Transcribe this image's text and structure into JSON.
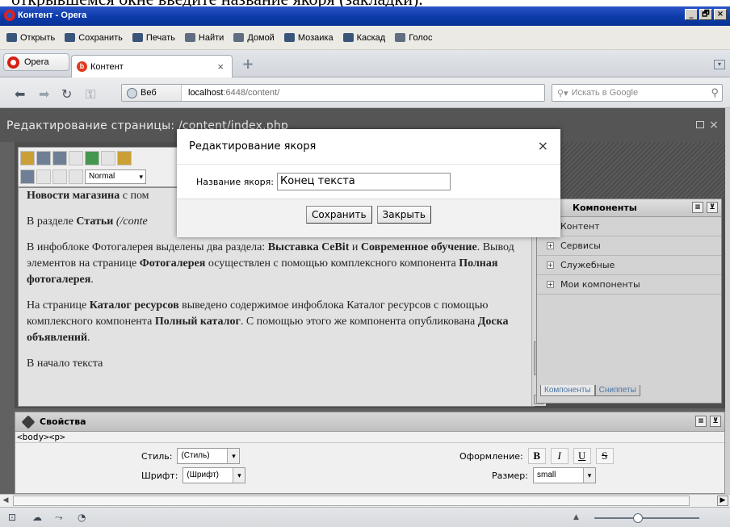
{
  "caption": "открывшемся окне введите название якоря (закладки).",
  "window": {
    "title": "Контент - Opera",
    "min": "_",
    "max": "🗗",
    "close": "×"
  },
  "toolbar": {
    "items": [
      {
        "label": "Открыть",
        "icon": "folder-icon"
      },
      {
        "label": "Сохранить",
        "icon": "save-icon"
      },
      {
        "label": "Печать",
        "icon": "print-icon"
      },
      {
        "label": "Найти",
        "icon": "search-icon"
      },
      {
        "label": "Домой",
        "icon": "home-icon"
      },
      {
        "label": "Мозаика",
        "icon": "tile-icon"
      },
      {
        "label": "Каскад",
        "icon": "cascade-icon"
      },
      {
        "label": "Голос",
        "icon": "voice-icon"
      }
    ]
  },
  "tabs": {
    "opera_menu": "Opera",
    "active_tab": "Контент",
    "tab_close": "×",
    "new_tab": "+",
    "tab_menu": "▾"
  },
  "address": {
    "web_label": "Веб",
    "url_host": "localhost",
    "url_rest": ":6448/content/",
    "search_placeholder": "Искать в Google"
  },
  "editor": {
    "title": "Редактирование страницы: /content/index.php",
    "style_select": "Normal",
    "paragraphs": [
      {
        "bold": "Новости магазина",
        "text": " с пом"
      },
      {
        "pre": "В разделе ",
        "bold": "Статьи",
        "text": " (/conte"
      },
      {
        "pre": "В инфоблоке Фотогалерея выделены два раздела: ",
        "bold": "Выставка CeBit",
        "mid": " и ",
        "bold2": "Современное обучение",
        "mid2": ". Вывод элементов на странице ",
        "bold3": "Фотогалерея",
        "mid3": " осуществлен с помощью комплексного компонента ",
        "bold4": "Полная фотогалерея",
        "text": "."
      },
      {
        "pre": "На странице ",
        "bold": "Каталог ресурсов",
        "mid": " выведено содержимое инфоблока Каталог ресурсов с помощью комплексного компонента ",
        "bold2": "Полный каталог",
        "mid2": ". С помощью этого же компонента опубликована ",
        "bold3": "Доска объявлений",
        "text": "."
      },
      {
        "pre": "В начало текста"
      }
    ]
  },
  "components": {
    "title": "Компоненты",
    "items": [
      "Контент",
      "Сервисы",
      "Служебные",
      "Мои компоненты"
    ],
    "tabs": [
      "Компоненты",
      "Сниппеты"
    ]
  },
  "properties": {
    "title": "Свойства",
    "breadcrumb": "<body><p>",
    "style_label": "Стиль:",
    "style_value": "(Стиль)",
    "font_label": "Шрифт:",
    "font_value": "(Шрифт)",
    "format_label": "Оформление:",
    "format_buttons": [
      "B",
      "I",
      "U",
      "S"
    ],
    "size_label": "Размер:",
    "size_value": "small"
  },
  "modal": {
    "title": "Редактирование якоря",
    "close": "×",
    "field_label": "Название якоря:",
    "field_value": "Конец текста",
    "save": "Сохранить",
    "cancel": "Закрыть"
  },
  "colors": {
    "titlebar": "#0b3aa8",
    "overlay": "#616161",
    "accent_red": "#d61e12"
  }
}
